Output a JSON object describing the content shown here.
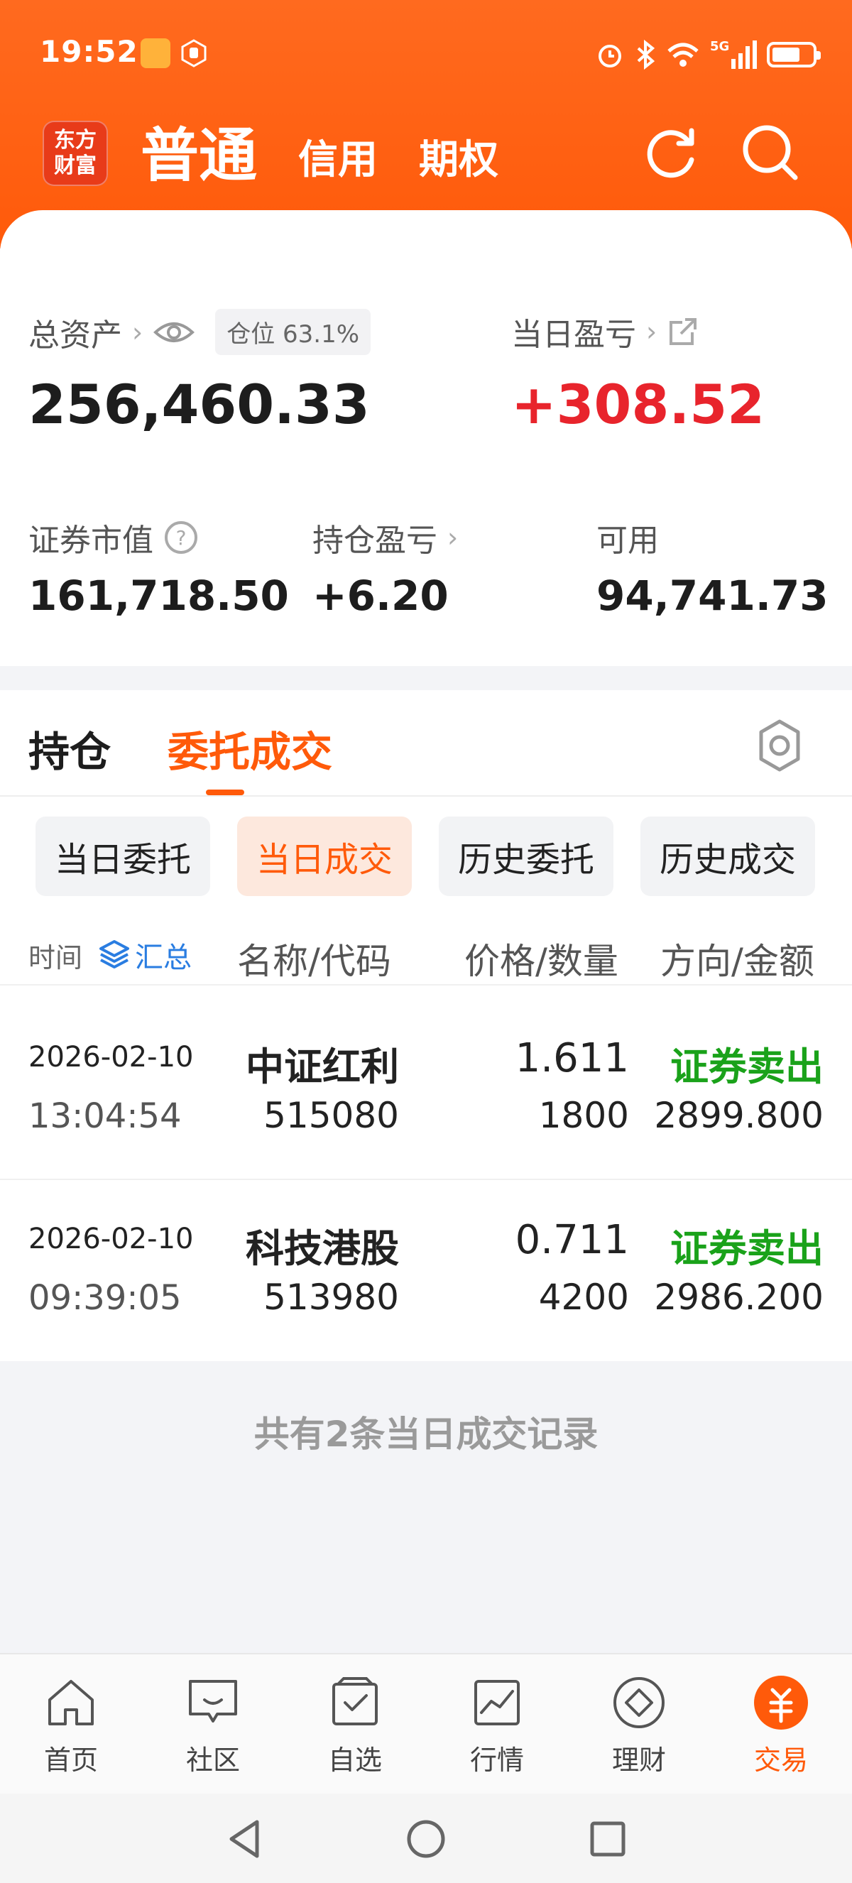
{
  "status_bar": {
    "time": "19:52",
    "network": "5G"
  },
  "header": {
    "logo_line1": "东方",
    "logo_line2": "财富",
    "tabs": [
      {
        "label": "普通",
        "active": true
      },
      {
        "label": "信用",
        "active": false
      },
      {
        "label": "期权",
        "active": false
      }
    ]
  },
  "assets": {
    "total_label": "总资产",
    "position_label": "仓位",
    "position_value": "63.1%",
    "total_value": "256,460.33",
    "daily_pl_label": "当日盈亏",
    "daily_pl_value": "+308.52",
    "market_value_label": "证券市值",
    "market_value": "161,718.50",
    "holding_pl_label": "持仓盈亏",
    "holding_pl_value": "+6.20",
    "available_label": "可用",
    "available_value": "94,741.73"
  },
  "main_tabs": [
    {
      "label": "持仓",
      "active": false
    },
    {
      "label": "委托成交",
      "active": true
    }
  ],
  "sub_tabs": [
    {
      "label": "当日委托",
      "active": false
    },
    {
      "label": "当日成交",
      "active": true
    },
    {
      "label": "历史委托",
      "active": false
    },
    {
      "label": "历史成交",
      "active": false
    }
  ],
  "table": {
    "headers": {
      "time": "时间",
      "summary": "汇总",
      "name_code": "名称/代码",
      "price_qty": "价格/数量",
      "dir_amount": "方向/金额"
    },
    "rows": [
      {
        "date": "2026-02-10",
        "time": "13:04:54",
        "name": "中证红利",
        "code": "515080",
        "price": "1.611",
        "qty": "1800",
        "direction": "证券卖出",
        "amount": "2899.800"
      },
      {
        "date": "2026-02-10",
        "time": "09:39:05",
        "name": "科技港股",
        "code": "513980",
        "price": "0.711",
        "qty": "4200",
        "direction": "证券卖出",
        "amount": "2986.200"
      }
    ]
  },
  "footer_note": "共有2条当日成交记录",
  "bottom_nav": [
    {
      "label": "首页",
      "icon": "home-icon"
    },
    {
      "label": "社区",
      "icon": "community-icon"
    },
    {
      "label": "自选",
      "icon": "watchlist-icon"
    },
    {
      "label": "行情",
      "icon": "market-icon"
    },
    {
      "label": "理财",
      "icon": "wealth-icon"
    },
    {
      "label": "交易",
      "icon": "trade-icon",
      "active": true
    }
  ],
  "colors": {
    "brand": "#ff5a0a",
    "profit": "#e8242c",
    "sell": "#1aa21a",
    "link": "#2a7de1"
  }
}
